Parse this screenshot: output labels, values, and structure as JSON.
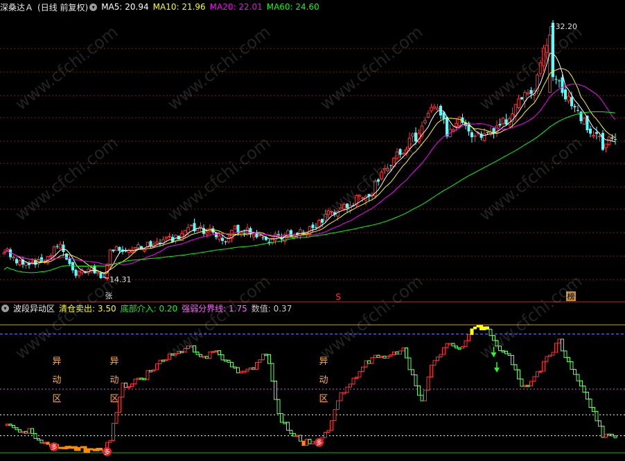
{
  "colors": {
    "up": "#ff3232",
    "down": "#54ffff",
    "ma5": "#ffffff",
    "ma10": "#ffff00",
    "ma20": "#ff00ff",
    "ma60": "#00ff00",
    "grid": "#7a1a1a",
    "separator": "#b03030"
  },
  "main_panel": {
    "stock_name": "深桑达Ａ",
    "period": "(日线 前复权)",
    "ma_labels": [
      {
        "text": "MA5: 20.94",
        "color": "#ffffff"
      },
      {
        "text": "MA10: 21.96",
        "color": "#ffff00"
      },
      {
        "text": "MA20: 22.01",
        "color": "#ff00ff"
      },
      {
        "text": "MA60: 24.60",
        "color": "#00ff00"
      }
    ],
    "high_label": "32.20",
    "low_label": "14.31",
    "markers": {
      "zhang": "张",
      "s": "S",
      "bang": "榜"
    }
  },
  "sub_panel": {
    "title": "波段异动区",
    "indicators": [
      {
        "text": "清仓卖出: 3.50",
        "color": "#ffff00"
      },
      {
        "text": "底部介入: 0.20",
        "color": "#00ff00"
      },
      {
        "text": "强弱分界线: 1.75",
        "color": "#ff66ff"
      },
      {
        "text": "数值: 0.37",
        "color": "#c8c8c8"
      }
    ],
    "zone_chars": [
      "异",
      "动",
      "区"
    ],
    "buy_badge": "多",
    "watermark": "www.cfchi.com"
  },
  "chart_data": [
    {
      "type": "candlestick",
      "title": "深桑达Ａ (日线 前复权)",
      "series_names": [
        "MA5",
        "MA10",
        "MA20",
        "MA60"
      ],
      "ma_current": {
        "MA5": 20.94,
        "MA10": 21.96,
        "MA20": 22.01,
        "MA60": 24.6
      },
      "marked_high": 32.2,
      "marked_low": 14.31,
      "close_path": [
        [
          0,
          16.4
        ],
        [
          6,
          15.2
        ],
        [
          12,
          15.5
        ],
        [
          18,
          16.7
        ],
        [
          22,
          14.6
        ],
        [
          28,
          14.8
        ],
        [
          32,
          14.3
        ],
        [
          34,
          16.3
        ],
        [
          44,
          16.5
        ],
        [
          50,
          16.9
        ],
        [
          56,
          17.1
        ],
        [
          60,
          17.8
        ],
        [
          66,
          17.6
        ],
        [
          70,
          16.8
        ],
        [
          74,
          17.7
        ],
        [
          80,
          17.5
        ],
        [
          84,
          17.0
        ],
        [
          90,
          17.4
        ],
        [
          96,
          17.5
        ],
        [
          100,
          17.9
        ],
        [
          104,
          19.0
        ],
        [
          108,
          19.3
        ],
        [
          112,
          19.7
        ],
        [
          118,
          20.6
        ],
        [
          122,
          22.3
        ],
        [
          128,
          23.3
        ],
        [
          134,
          25.0
        ],
        [
          138,
          26.5
        ],
        [
          142,
          24.8
        ],
        [
          146,
          25.6
        ],
        [
          150,
          24.4
        ],
        [
          154,
          24.3
        ],
        [
          158,
          24.8
        ],
        [
          162,
          25.7
        ],
        [
          166,
          27.3
        ],
        [
          170,
          27.8
        ],
        [
          172,
          29.6
        ],
        [
          174,
          31.1
        ],
        [
          175,
          32.2
        ],
        [
          176,
          28.8
        ],
        [
          180,
          27.1
        ],
        [
          184,
          26.3
        ],
        [
          188,
          24.6
        ],
        [
          192,
          23.8
        ],
        [
          196,
          24.4
        ]
      ]
    },
    {
      "type": "step",
      "title": "波段异动区",
      "series_names": [
        "清仓卖出",
        "底部介入",
        "强弱分界线",
        "数值"
      ],
      "levels": {
        "清仓卖出": 3.5,
        "底部介入": 0.2,
        "强弱分界线": 1.75,
        "数值": 0.37
      },
      "ylim": [
        0,
        3.6
      ],
      "value_path": [
        [
          0,
          0.75
        ],
        [
          8,
          0.6
        ],
        [
          14,
          0.2
        ],
        [
          24,
          0.12
        ],
        [
          32,
          0.05
        ],
        [
          34,
          0.4
        ],
        [
          38,
          1.85
        ],
        [
          44,
          2.0
        ],
        [
          50,
          2.55
        ],
        [
          56,
          2.8
        ],
        [
          60,
          2.9
        ],
        [
          64,
          2.6
        ],
        [
          68,
          2.8
        ],
        [
          72,
          2.45
        ],
        [
          76,
          2.15
        ],
        [
          80,
          2.35
        ],
        [
          84,
          2.75
        ],
        [
          86,
          2.05
        ],
        [
          88,
          1.0
        ],
        [
          92,
          0.55
        ],
        [
          96,
          0.3
        ],
        [
          100,
          0.3
        ],
        [
          104,
          0.7
        ],
        [
          108,
          1.6
        ],
        [
          112,
          2.05
        ],
        [
          116,
          2.5
        ],
        [
          120,
          2.65
        ],
        [
          124,
          2.7
        ],
        [
          128,
          2.85
        ],
        [
          132,
          1.85
        ],
        [
          134,
          1.45
        ],
        [
          138,
          2.6
        ],
        [
          142,
          2.95
        ],
        [
          146,
          2.85
        ],
        [
          150,
          3.4
        ],
        [
          154,
          3.45
        ],
        [
          156,
          3.2
        ],
        [
          158,
          2.9
        ],
        [
          162,
          2.7
        ],
        [
          166,
          1.8
        ],
        [
          170,
          2.05
        ],
        [
          174,
          2.55
        ],
        [
          178,
          3.05
        ],
        [
          182,
          2.25
        ],
        [
          186,
          1.7
        ],
        [
          188,
          1.25
        ],
        [
          192,
          0.5
        ],
        [
          196,
          0.37
        ]
      ]
    }
  ]
}
